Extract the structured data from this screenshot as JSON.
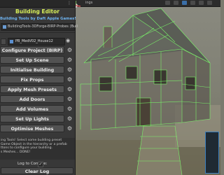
{
  "window": {
    "scene_tab_label": "ings"
  },
  "panel": {
    "menu_icon": "⋮",
    "title": "Building Editor",
    "subtitle": "Building Tools by Daft Apple Games!",
    "asset_field": "BuildingTools-3DForge-BIRP-Probes (Buil",
    "object_field": "PB_MedV02_House12",
    "buttons": [
      {
        "label": "Configure Project (BIRP)"
      },
      {
        "label": "Set Up Scene"
      },
      {
        "label": "Initialise Building"
      },
      {
        "label": "Fix Props"
      },
      {
        "label": "Apply Mesh Presets"
      },
      {
        "label": "Add Doors"
      },
      {
        "label": "Add Volumes"
      },
      {
        "label": "Set Up Lights"
      },
      {
        "label": "Optimise Meshes"
      }
    ],
    "log_text": "ing Tools! Select some building preset\nGame Object in the hierarchy or a prefab\nttons to configure your building.\ns Meshes... DONE!",
    "log_to_console_label": "Log to Console:",
    "log_to_console_checked": "✓",
    "clear_log_label": "Clear Log"
  },
  "colors": {
    "title": "#d8f05a",
    "subtitle": "#6fb4f2",
    "wireframe": "#7cff6a"
  }
}
